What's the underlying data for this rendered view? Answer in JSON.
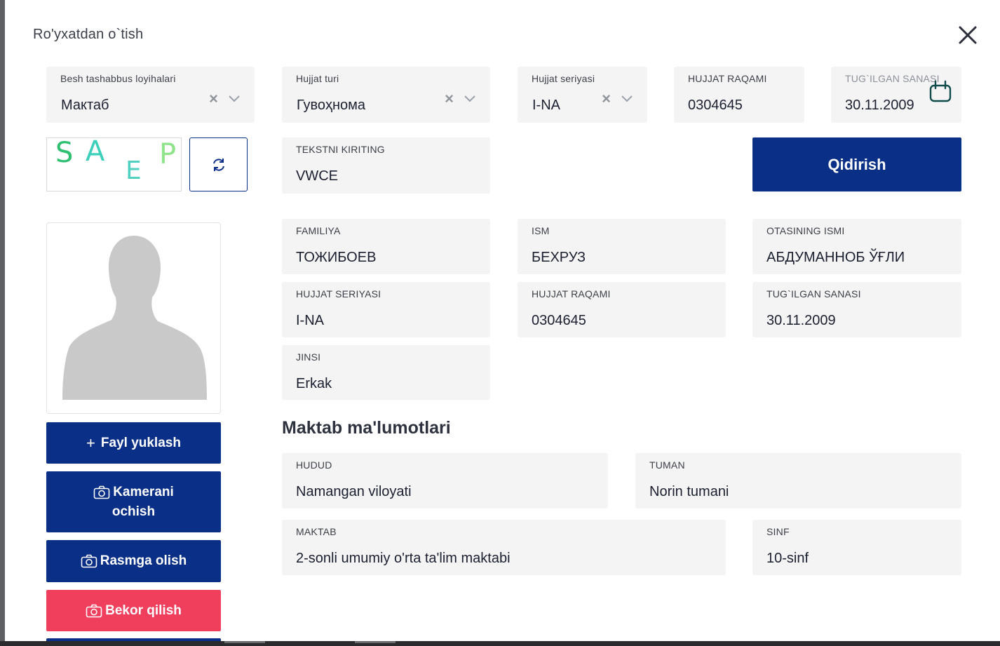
{
  "dialog": {
    "title": "Ro'yxatdan o`tish"
  },
  "top_fields": {
    "project": {
      "label": "Besh tashabbus loyihalari",
      "value": "Мактаб"
    },
    "doc_type": {
      "label": "Hujjat turi",
      "value": "Гувоҳнома"
    },
    "doc_series": {
      "label": "Hujjat seriyasi",
      "value": "I-NA"
    },
    "doc_number": {
      "label": "HUJJAT RAQAMI",
      "value": "0304645"
    },
    "birth_date": {
      "label": "TUG`ILGAN SANASI",
      "value": "30.11.2009"
    }
  },
  "captcha": {
    "chars": [
      "S",
      "A",
      "E",
      "P"
    ],
    "input_label": "TEKSTNI KIRITING",
    "input_value": "VWCE"
  },
  "search_button": "Qidirish",
  "person": {
    "surname": {
      "label": "FAMILIYA",
      "value": "ТОЖИБОЕВ"
    },
    "name": {
      "label": "ISM",
      "value": "БЕХРУЗ"
    },
    "patronymic": {
      "label": "OTASINING ISMI",
      "value": "АБДУМАННОБ ЎҒЛИ"
    },
    "series": {
      "label": "HUJJAT SERIYASI",
      "value": "I-NA"
    },
    "number": {
      "label": "HUJJAT RAQAMI",
      "value": "0304645"
    },
    "birth": {
      "label": "TUG`ILGAN SANASI",
      "value": "30.11.2009"
    },
    "gender": {
      "label": "JINSI",
      "value": "Erkak"
    }
  },
  "school_section": {
    "title": "Maktab ma'lumotlari",
    "region": {
      "label": "HUDUD",
      "value": "Namangan viloyati"
    },
    "district": {
      "label": "TUMAN",
      "value": "Norin tumani"
    },
    "school": {
      "label": "MAKTAB",
      "value": "2-sonli umumiy o'rta ta'lim maktabi"
    },
    "grade": {
      "label": "SINF",
      "value": "10-sinf"
    }
  },
  "buttons": {
    "upload": "Fayl yuklash",
    "camera_line1": "Kamerani",
    "camera_line2": "ochish",
    "capture": "Rasmga olish",
    "cancel": "Bekor qilish"
  },
  "colors": {
    "primary": "#0a2f86",
    "danger": "#f03e5d",
    "field_bg": "#f4f4f5"
  },
  "icons": [
    "close-icon",
    "chevron-down-icon",
    "clear-icon",
    "calendar-icon",
    "refresh-icon",
    "plus-icon",
    "camera-icon",
    "avatar-placeholder"
  ]
}
